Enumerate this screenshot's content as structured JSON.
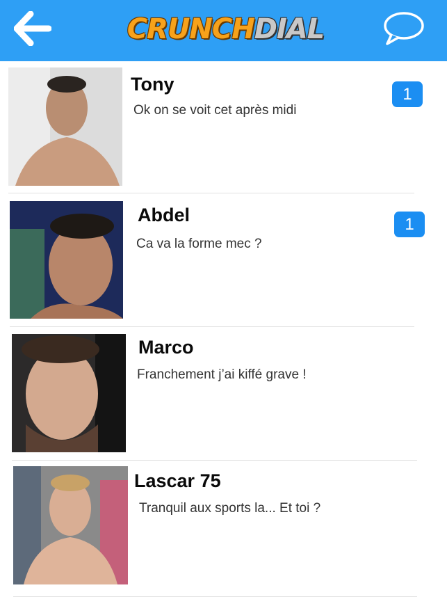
{
  "header": {
    "app_name_part1": "CRUNCH",
    "app_name_part2": "DIAL",
    "back_icon": "arrow-left-icon",
    "chat_icon": "speech-bubble-icon",
    "bar_color": "#2e9ff5"
  },
  "conversations": [
    {
      "name": "Tony",
      "message": "Ok on se voit cet après midi",
      "unread": "1"
    },
    {
      "name": "Abdel",
      "message": "Ca va la forme mec ?",
      "unread": "1"
    },
    {
      "name": "Marco",
      "message": "Franchement j’ai kiffé grave !"
    },
    {
      "name": "Lascar 75",
      "message": "Tranquil aux sports la... Et toi ?"
    }
  ],
  "colors": {
    "badge": "#1b8ef2",
    "divider": "#e2e2e2"
  }
}
